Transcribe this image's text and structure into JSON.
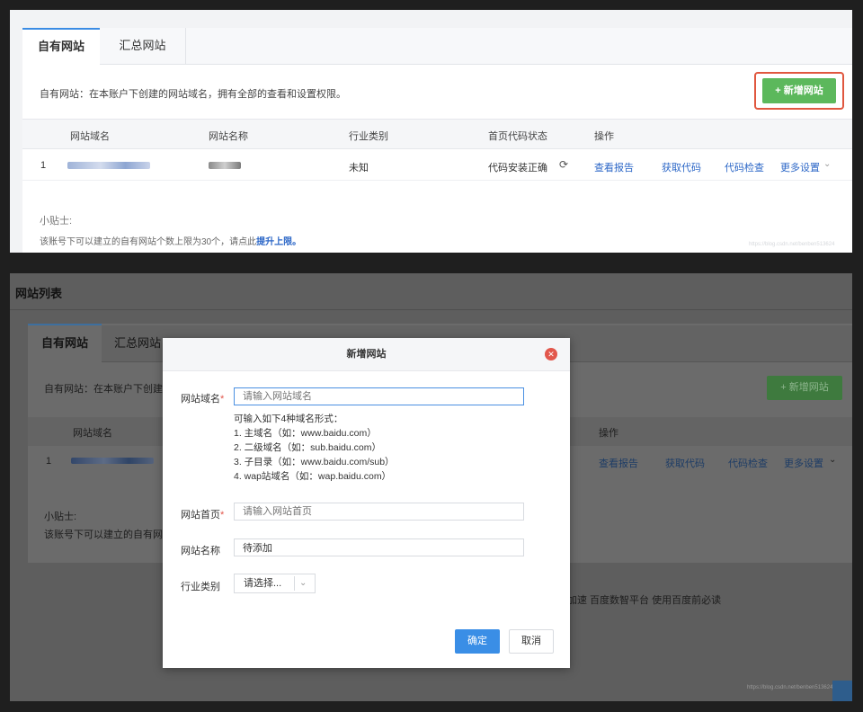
{
  "top": {
    "tabs": [
      "自有网站",
      "汇总网站"
    ],
    "description": "自有网站：在本账户下创建的网站域名，拥有全部的查看和设置权限。",
    "add_button": "+ 新增网站",
    "columns": [
      "网站域名",
      "网站名称",
      "行业类别",
      "首页代码状态",
      "操作"
    ],
    "row": {
      "index": "1",
      "industry": "未知",
      "code_status": "代码安装正确",
      "actions": [
        "查看报告",
        "获取代码",
        "代码检查",
        "更多设置"
      ]
    },
    "tip_title": "小贴士:",
    "tip_text": "该账号下可以建立的自有网站个数上限为30个，请点此",
    "tip_link": "提升上限。"
  },
  "bottom": {
    "page_title": "网站列表",
    "tabs": [
      "自有网站",
      "汇总网站"
    ],
    "description_partial": "自有网站：在本账户下创建的",
    "add_button": "+ 新增网站",
    "column_domain": "网站域名",
    "column_actions": "操作",
    "row_index": "1",
    "actions": [
      "查看报告",
      "获取代码",
      "代码检查",
      "更多设置"
    ],
    "tip_title": "小贴士:",
    "tip_text_partial": "该账号下可以建立的自有网站",
    "footer_links": "加速  百度数智平台  使用百度前必读",
    "watermark": "https://blog.csdn.net/benben513624"
  },
  "modal": {
    "title": "新增网站",
    "domain_label": "网站域名",
    "domain_placeholder": "请输入网站域名",
    "hints": [
      "可输入如下4种域名形式：",
      "1. 主域名（如：www.baidu.com）",
      "2. 二级域名（如：sub.baidu.com）",
      "3. 子目录（如：www.baidu.com/sub）",
      "4. wap站域名（如：wap.baidu.com）"
    ],
    "homepage_label": "网站首页",
    "homepage_placeholder": "请输入网站首页",
    "name_label": "网站名称",
    "name_value": "待添加",
    "industry_label": "行业类别",
    "industry_value": "请选择...",
    "confirm": "确定",
    "cancel": "取消",
    "required_mark": "*"
  },
  "colors": {
    "add_button_green": "#5cb85c",
    "link_blue": "#2c67c7",
    "highlight_red": "#e0573f",
    "confirm_blue": "#3a8ee6"
  }
}
